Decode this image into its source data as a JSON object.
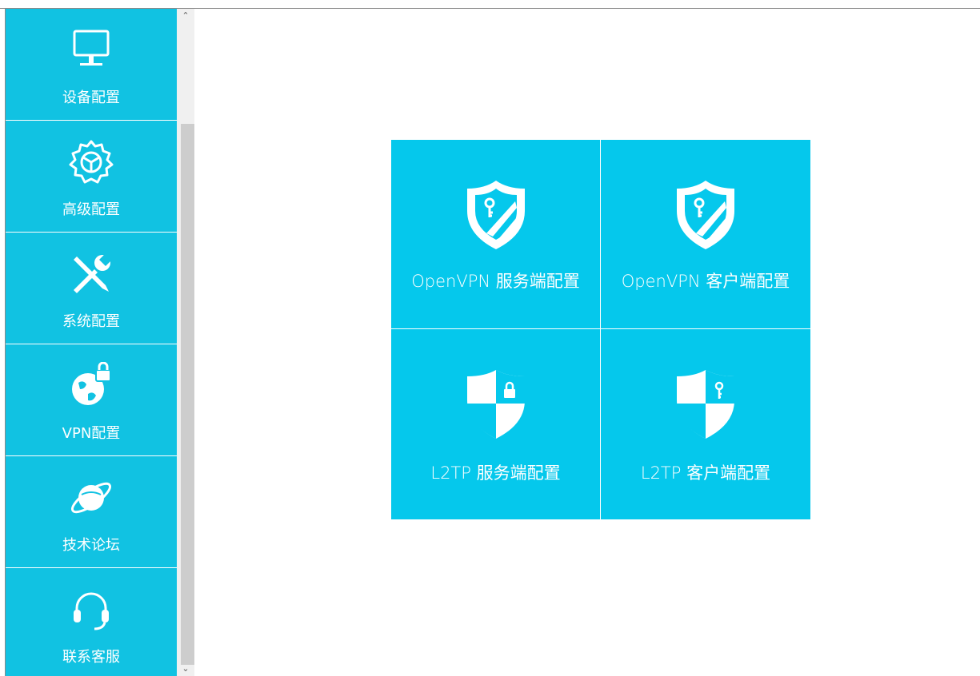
{
  "sidebar": {
    "items": [
      {
        "label": "设备配置",
        "icon": "monitor-icon"
      },
      {
        "label": "高级配置",
        "icon": "settings-gear-icon"
      },
      {
        "label": "系统配置",
        "icon": "tools-icon"
      },
      {
        "label": "VPN配置",
        "icon": "globe-lock-icon"
      },
      {
        "label": "技术论坛",
        "icon": "planet-icon"
      },
      {
        "label": "联系客服",
        "icon": "headset-icon"
      }
    ]
  },
  "scrollbar": {
    "up_arrow": "⌃",
    "down_arrow": "⌄"
  },
  "tiles": [
    {
      "label": "OpenVPN 服务端配置",
      "icon": "shield-key-icon"
    },
    {
      "label": "OpenVPN 客户端配置",
      "icon": "shield-key-icon"
    },
    {
      "label": "L2TP 服务端配置",
      "icon": "shield-lock-icon"
    },
    {
      "label": "L2TP 客户端配置",
      "icon": "shield-key-icon"
    }
  ],
  "colors": {
    "sidebar_bg": "#11c2e2",
    "tile_bg": "#05c8ec",
    "text": "#ffffff"
  }
}
